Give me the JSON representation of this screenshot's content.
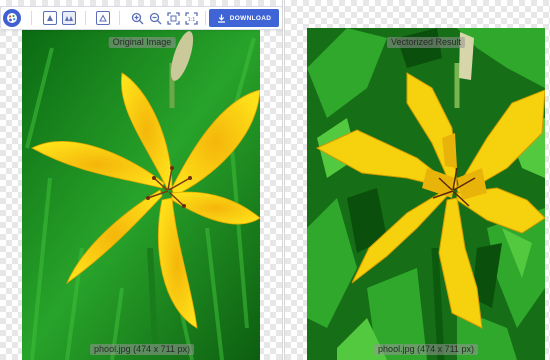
{
  "toolbar": {
    "download_label": "DOWNLOAD",
    "icons": [
      "palette-icon",
      "triangle-box-icon",
      "split-view-icon",
      "single-view-icon",
      "zoom-in-icon",
      "zoom-out-icon",
      "fit-screen-icon",
      "actual-size-icon",
      "download-icon"
    ]
  },
  "panels": {
    "left": {
      "label": "Original Image",
      "file_info": "phool.jpg (474 x 711 px)"
    },
    "right": {
      "label": "Vectorized Result",
      "file_info": "phool.jpg (474 x 711 px)"
    }
  },
  "colors": {
    "accent": "#3e64d6",
    "petal": "#f6d10d",
    "foliage": "#1f9e1f"
  }
}
